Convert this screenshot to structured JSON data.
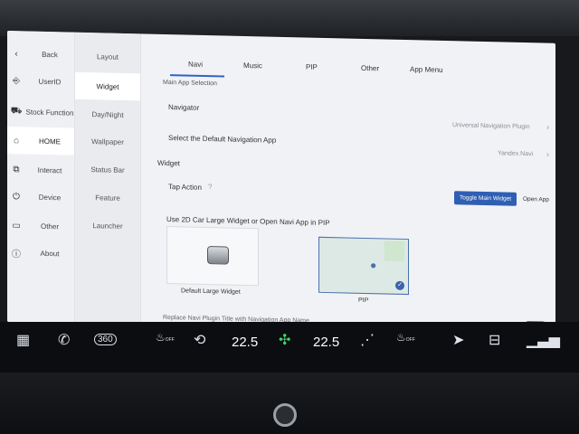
{
  "sidebar": {
    "items": [
      {
        "label": "Back",
        "icon": "chevron-left-icon"
      },
      {
        "label": "UserID",
        "icon": "user-icon"
      },
      {
        "label": "Stock Function",
        "icon": "car-icon"
      },
      {
        "label": "HOME",
        "icon": "home-icon",
        "active": true
      },
      {
        "label": "Interact",
        "icon": "interact-icon"
      },
      {
        "label": "Device",
        "icon": "power-icon"
      },
      {
        "label": "Other",
        "icon": "box-icon"
      },
      {
        "label": "About",
        "icon": "info-icon"
      }
    ]
  },
  "subnav": {
    "items": [
      {
        "label": "Layout"
      },
      {
        "label": "Widget",
        "active": true
      },
      {
        "label": "Day/Night"
      },
      {
        "label": "Wallpaper"
      },
      {
        "label": "Status Bar"
      },
      {
        "label": "Feature"
      },
      {
        "label": "Launcher"
      }
    ]
  },
  "tabs": [
    "Navi",
    "Music",
    "PIP",
    "Other",
    "App Menu"
  ],
  "content": {
    "section_partial_top": "Main App Selection",
    "navigator_label": "Navigator",
    "navigator_value": "Universal Navigation Plugin",
    "default_nav_label": "Select the Default Navigation App",
    "default_nav_value": "Yandex.Navi",
    "widget_header": "Widget",
    "tap_action_label": "Tap Action",
    "toggle_widget_btn": "Toggle Main Widget",
    "open_app_btn": "Open App",
    "large_widget_prompt": "Use 2D Car Large Widget or Open Navi App in PIP",
    "option_default": "Default Large Widget",
    "option_pip": "PIP",
    "bottom_partial": "Replace Navi Plugin Title with Navigation App Name"
  },
  "dock": {
    "temp_left": "22.5",
    "temp_right": "22.5",
    "icons": [
      "grid-icon",
      "phone-icon",
      "camera-360-icon",
      "seat-heat-off-icon",
      "car-recirculation-icon",
      "fan-icon",
      "windshield-defrost-icon",
      "seat-vent-off-icon",
      "navigation-arrow-icon",
      "rear-defrost-icon",
      "fan-speed-icon"
    ],
    "label_360": "360",
    "label_off": "OFF"
  },
  "colors": {
    "accent": "#2f5fb3",
    "screen_bg": "#f1f2f5"
  }
}
